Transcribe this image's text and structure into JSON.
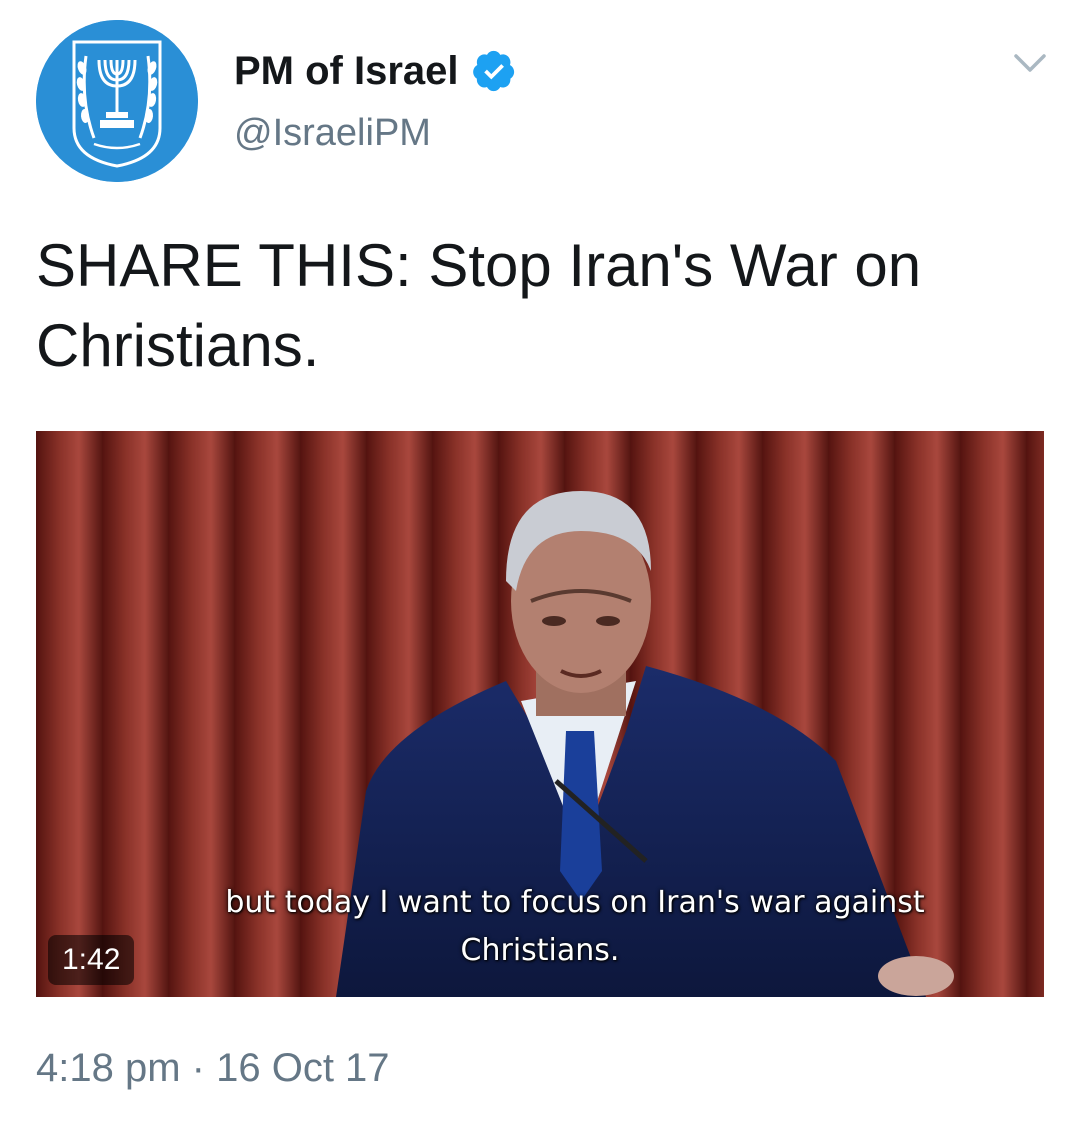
{
  "account": {
    "display_name": "PM of Israel",
    "handle": "@IsraeliPM",
    "verified": true
  },
  "tweet": {
    "text": "SHARE THIS: Stop Iran's War on Christians."
  },
  "media": {
    "subtitle_line1": "but today I want to focus on Iran's war against",
    "subtitle_line2": "Christians.",
    "duration": "1:42"
  },
  "meta": {
    "time": "4:18 pm",
    "separator": "·",
    "date": "16 Oct 17"
  },
  "colors": {
    "verified_badge": "#1da1f2",
    "avatar_bg": "#2a8fd6",
    "secondary_text": "#657786",
    "primary_text": "#14171a"
  },
  "icons": {
    "avatar": "israel-emblem-icon",
    "verified": "verified-badge-icon",
    "caret": "chevron-down-icon"
  }
}
